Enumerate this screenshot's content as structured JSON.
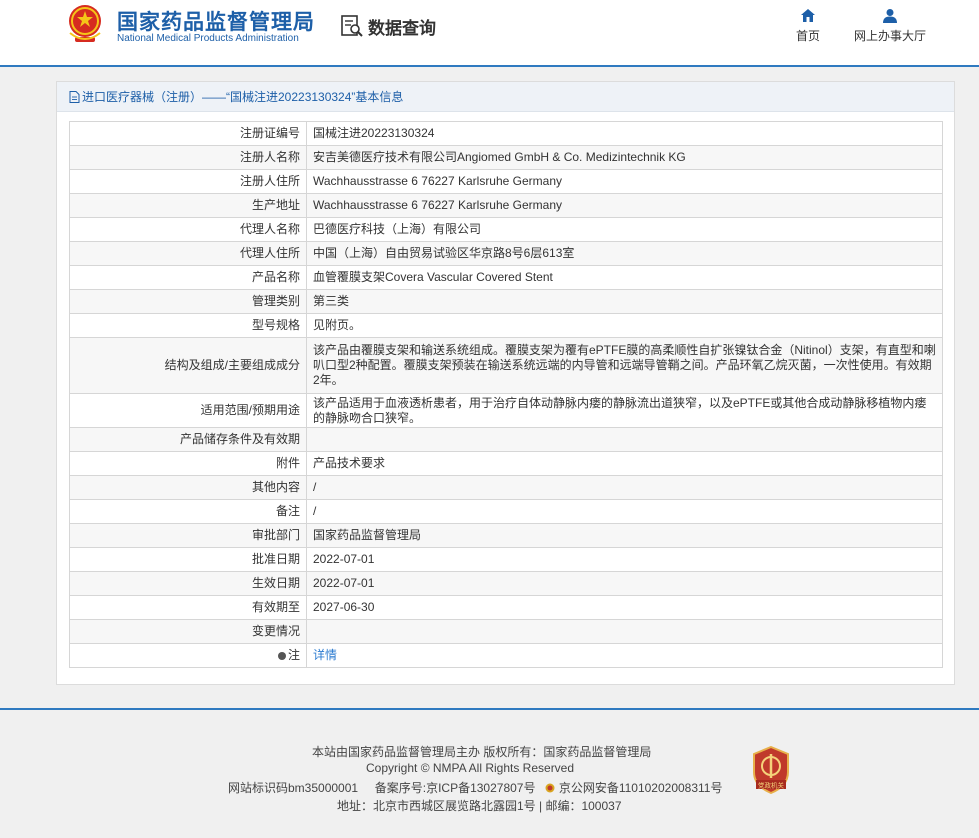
{
  "header": {
    "brand_cn": "国家药品监督管理局",
    "brand_en": "National Medical Products Administration",
    "query_label": "数据查询",
    "nav": [
      {
        "label": "首页",
        "icon": "home-icon"
      },
      {
        "label": "网上办事大厅",
        "icon": "user-icon"
      }
    ]
  },
  "panel": {
    "title": "进口医疗器械（注册）——“国械注进20223130324”基本信息",
    "rows": [
      {
        "label": "注册证编号",
        "value": "国械注进20223130324"
      },
      {
        "label": "注册人名称",
        "value": "安吉美德医疗技术有限公司Angiomed GmbH & Co. Medizintechnik KG"
      },
      {
        "label": "注册人住所",
        "value": "Wachhausstrasse 6 76227 Karlsruhe Germany"
      },
      {
        "label": "生产地址",
        "value": "Wachhausstrasse 6 76227 Karlsruhe Germany"
      },
      {
        "label": "代理人名称",
        "value": "巴德医疗科技（上海）有限公司"
      },
      {
        "label": "代理人住所",
        "value": "中国（上海）自由贸易试验区华京路8号6层613室"
      },
      {
        "label": "产品名称",
        "value": "血管覆膜支架Covera Vascular Covered Stent"
      },
      {
        "label": "管理类别",
        "value": "第三类"
      },
      {
        "label": "型号规格",
        "value": "见附页。"
      },
      {
        "label": "结构及组成/主要组成成分",
        "value": "该产品由覆膜支架和输送系统组成。覆膜支架为覆有ePTFE膜的高柔顺性自扩张镍钛合金（Nitinol）支架，有直型和喇叭口型2种配置。覆膜支架预装在输送系统远端的内导管和远端导管鞘之间。产品环氧乙烷灭菌，一次性使用。有效期2年。"
      },
      {
        "label": "适用范围/预期用途",
        "value": "该产品适用于血液透析患者，用于治疗自体动静脉内瘘的静脉流出道狭窄，以及ePTFE或其他合成动静脉移植物内瘘的静脉吻合口狭窄。"
      },
      {
        "label": "产品储存条件及有效期",
        "value": ""
      },
      {
        "label": "附件",
        "value": "产品技术要求"
      },
      {
        "label": "其他内容",
        "value": "/"
      },
      {
        "label": "备注",
        "value": "/"
      },
      {
        "label": "审批部门",
        "value": "国家药品监督管理局"
      },
      {
        "label": "批准日期",
        "value": "2022-07-01"
      },
      {
        "label": "生效日期",
        "value": "2022-07-01"
      },
      {
        "label": "有效期至",
        "value": "2027-06-30"
      },
      {
        "label": "变更情况",
        "value": ""
      },
      {
        "label": "注",
        "value": "详情"
      }
    ]
  },
  "footer": {
    "line1": "本站由国家药品监督管理局主办 版权所有：国家药品监督管理局",
    "line2": "Copyright © NMPA All Rights Reserved",
    "site_id": "网站标识码bm35000001",
    "icp": "备案序号:京ICP备13027807号",
    "police": "京公网安备11010202008311号",
    "line4": "地址：北京市西城区展览路北露园1号 | 邮编：100037",
    "badge_text": "党政机关"
  },
  "colors": {
    "brand_blue": "#1d5fa8",
    "link_blue": "#2b7bd0",
    "badge_red": "#c0392b"
  }
}
